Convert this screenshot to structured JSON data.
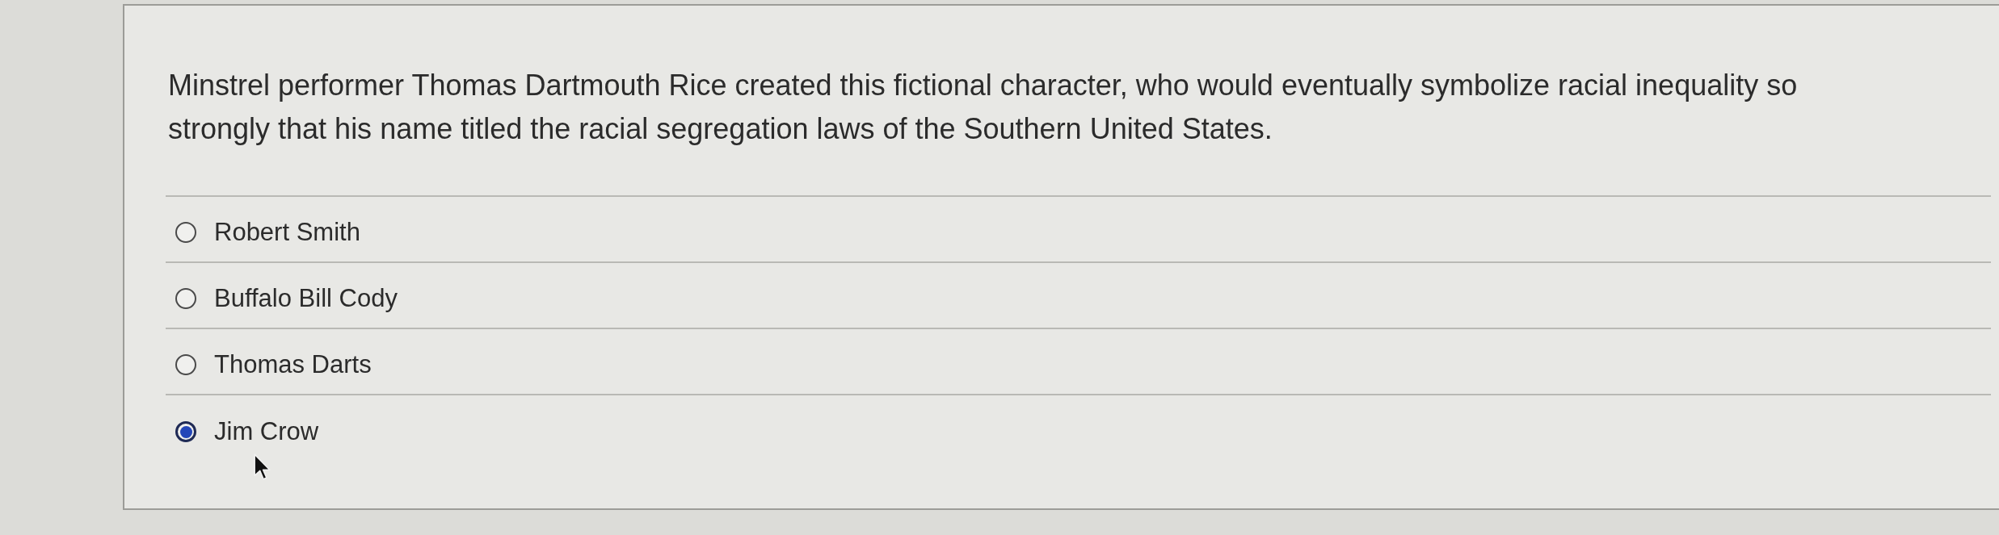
{
  "question": {
    "text": "Minstrel performer Thomas Dartmouth Rice created this fictional character, who would eventually symbolize racial inequality so strongly that his name titled the racial segregation laws of the Southern United States."
  },
  "options": [
    {
      "label": "Robert Smith",
      "selected": false
    },
    {
      "label": "Buffalo Bill Cody",
      "selected": false
    },
    {
      "label": "Thomas Darts",
      "selected": false
    },
    {
      "label": "Jim Crow",
      "selected": true
    }
  ]
}
